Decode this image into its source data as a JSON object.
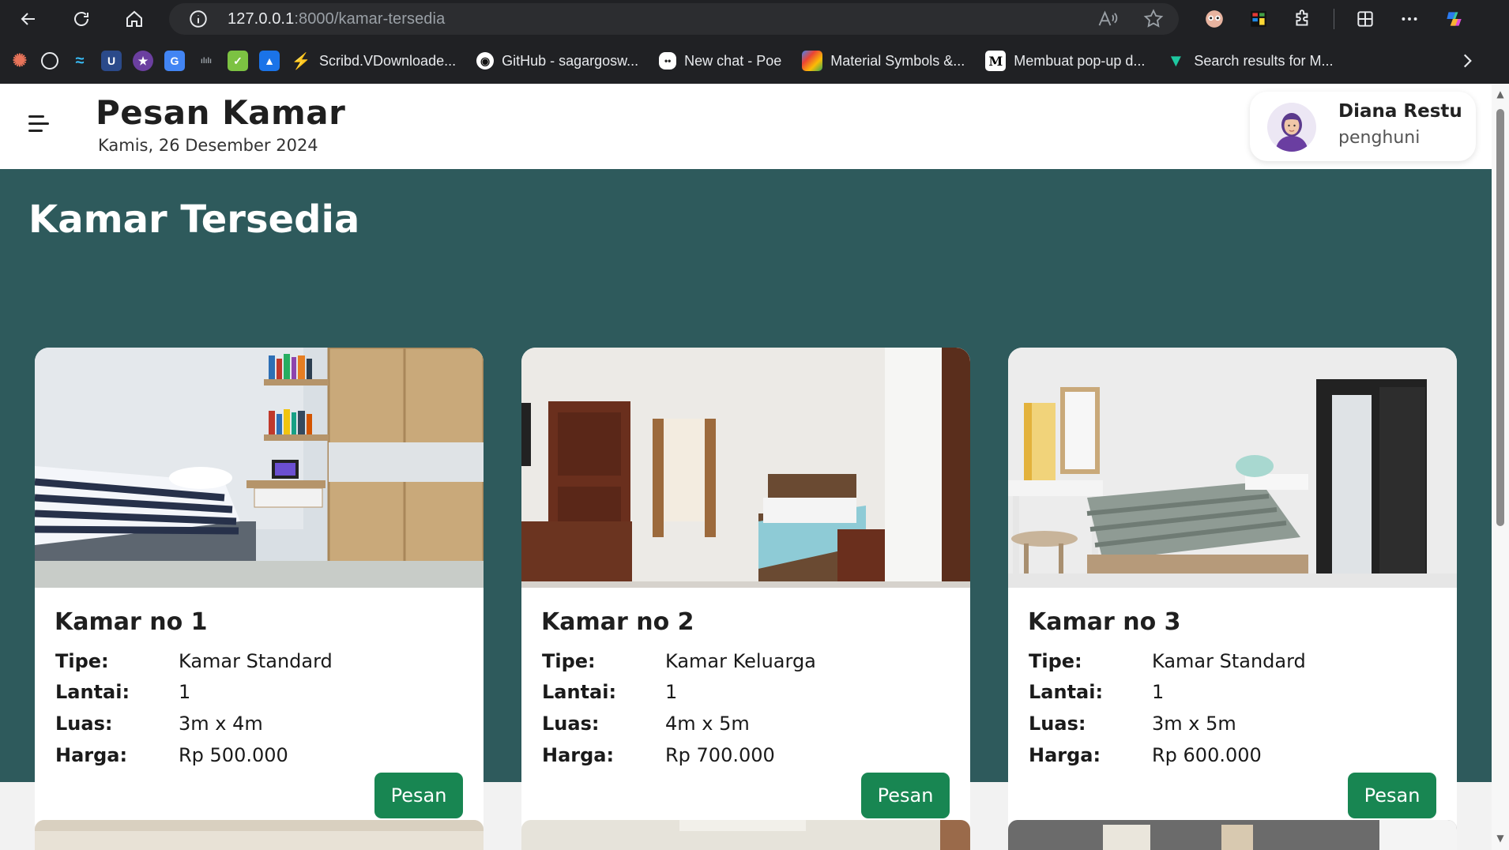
{
  "browser": {
    "url_host": "127.0.0.1",
    "url_path": ":8000/kamar-tersedia",
    "bookmarks": [
      {
        "label": "Scribd.VDownloade...",
        "icon": "bolt-icon",
        "color": "#f4c20d"
      },
      {
        "label": "GitHub - sagargosw...",
        "icon": "github-icon",
        "color": "#ffffff"
      },
      {
        "label": "New chat - Poe",
        "icon": "poe-icon",
        "color": "#ffffff"
      },
      {
        "label": "Material Symbols &...",
        "icon": "material-icon",
        "color": "#4285f4"
      },
      {
        "label": "Membuat pop-up d...",
        "icon": "medium-icon",
        "color": "#ffffff"
      },
      {
        "label": "Search results for M...",
        "icon": "v-icon",
        "color": "#1ec8a0"
      }
    ]
  },
  "header": {
    "title": "Pesan Kamar",
    "date": "Kamis, 26 Desember 2024",
    "user_name": "Diana Restu",
    "user_role": "penghuni"
  },
  "section": {
    "title": "Kamar Tersedia"
  },
  "labels": {
    "tipe": "Tipe:",
    "lantai": "Lantai:",
    "luas": "Luas:",
    "harga": "Harga:",
    "button": "Pesan"
  },
  "rooms": [
    {
      "name": "Kamar no 1",
      "tipe": "Kamar Standard",
      "lantai": "1",
      "luas": "3m x 4m",
      "harga": "Rp 500.000"
    },
    {
      "name": "Kamar no 2",
      "tipe": "Kamar Keluarga",
      "lantai": "1",
      "luas": "4m x 5m",
      "harga": "Rp 700.000"
    },
    {
      "name": "Kamar no 3",
      "tipe": "Kamar Standard",
      "lantai": "1",
      "luas": "3m x 5m",
      "harga": "Rp 600.000"
    }
  ],
  "colors": {
    "section_bg": "#2e5a5c",
    "button_bg": "#188652"
  }
}
